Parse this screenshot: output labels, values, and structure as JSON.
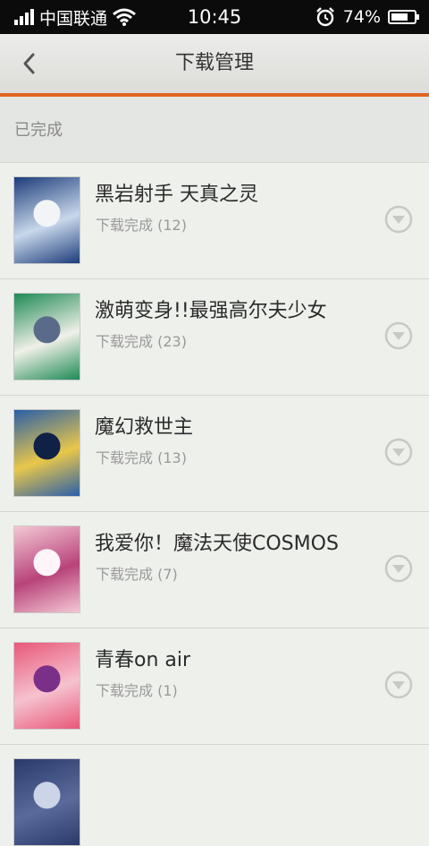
{
  "status_bar": {
    "carrier": "中国联通",
    "time": "10:45",
    "battery_percent_label": "74%",
    "battery_level": 0.74
  },
  "navbar": {
    "title": "下载管理"
  },
  "section": {
    "label": "已完成"
  },
  "items": [
    {
      "title": "黑岩射手 天真之灵",
      "status": "下载完成 (12)",
      "cover_colors": [
        "#1d3d7a",
        "#c8d8ec",
        "#f2f4f6"
      ]
    },
    {
      "title": "激萌变身!!最强高尔夫少女",
      "status": "下载完成 (23)",
      "cover_colors": [
        "#1f8a55",
        "#f0f0e8",
        "#5a6b8a"
      ]
    },
    {
      "title": "魔幻救世主",
      "status": "下载完成 (13)",
      "cover_colors": [
        "#2a5fa8",
        "#e9c74a",
        "#0f2245"
      ]
    },
    {
      "title": "我爱你！魔法天使COSMOS",
      "status": "下载完成 (7)",
      "cover_colors": [
        "#f4c8d4",
        "#b8437a",
        "#fff4f8"
      ]
    },
    {
      "title": "青春on air",
      "status": "下载完成 (1)",
      "cover_colors": [
        "#e8587a",
        "#f6c2cf",
        "#7a2f88"
      ]
    },
    {
      "title": "",
      "status": "",
      "cover_colors": [
        "#2a3a6a",
        "#5a6a9a",
        "#ccd4e8"
      ]
    }
  ],
  "colors": {
    "accent": "#e0651f",
    "background": "#eef0ec"
  }
}
